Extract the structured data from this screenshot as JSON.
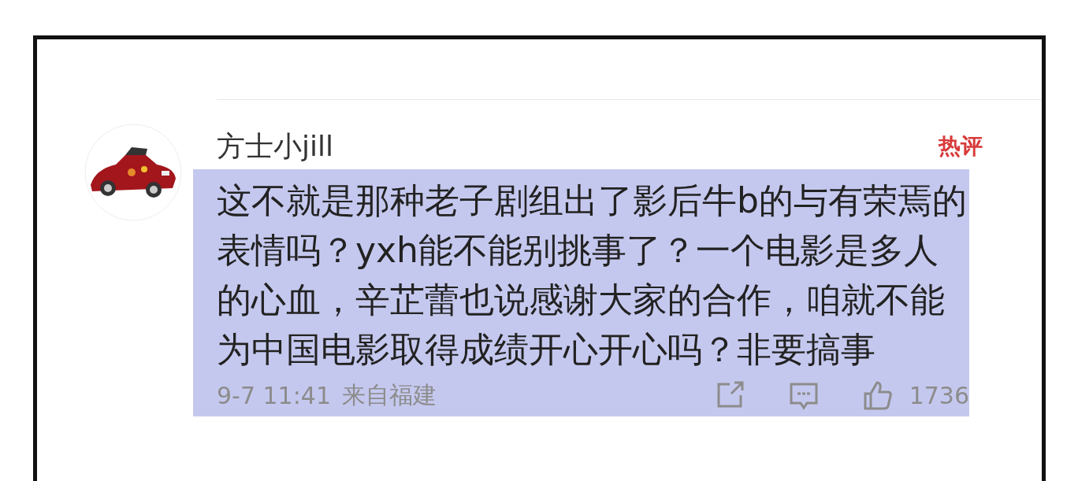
{
  "comment": {
    "username": "方士小jill",
    "badge": "热评",
    "text": "这不就是那种老子剧组出了影后牛b的与有荣焉的表情吗？yxh能不能别挑事了？一个电影是多人的心血，辛芷蕾也说感谢大家的合作，咱就不能为中国电影取得成绩开心开心吗？非要搞事",
    "highlighted": true,
    "time": "9-7 11:41",
    "location": "来自福建",
    "likes": "1736"
  }
}
